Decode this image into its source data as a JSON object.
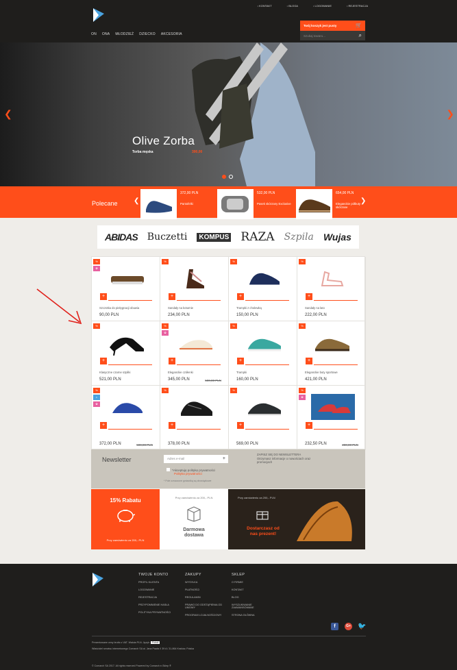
{
  "header": {
    "top_links": [
      "KONTAKT",
      "BLOGA",
      "LOGOWANIE",
      "REJESTRACJA"
    ],
    "nav": [
      "ON",
      "ONA",
      "MŁODZIEŻ",
      "DZIECKO",
      "AKCESORIA"
    ],
    "cart_label": "Twój koszyk jest pusty",
    "search_placeholder": "Szukaj towaru..."
  },
  "hero": {
    "title": "Olive Zorba",
    "subtitle": "Torba męska",
    "price": "390,00"
  },
  "recommended": {
    "title": "Polecane",
    "items": [
      {
        "price": "372,00 PLN",
        "name": "Pantofelki"
      },
      {
        "price": "532,00 PLN",
        "name": "Pasek skórzany Exclusive"
      },
      {
        "price": "654,00 PLN",
        "name": "Eleganckie półbuty skórzane"
      }
    ]
  },
  "brands": [
    "ABIDAS",
    "Buczetti",
    "KOMPUS",
    "RAZA",
    "Szpila",
    "Wujas"
  ],
  "products": [
    {
      "name": "Szczotka do pielęgnacji obuwia",
      "price": "90,00 PLN",
      "old": "",
      "badges": [
        "%",
        "✿"
      ]
    },
    {
      "name": "Sandały na koturnie",
      "price": "234,00 PLN",
      "old": "",
      "badges": [
        "%"
      ]
    },
    {
      "name": "Trampki z cholewką",
      "price": "150,00 PLN",
      "old": "",
      "badges": [
        "%"
      ]
    },
    {
      "name": "Sandały na lato",
      "price": "222,00 PLN",
      "old": "",
      "badges": [
        "%"
      ]
    },
    {
      "name": "Klasyczne czarne szpilki",
      "price": "521,00 PLN",
      "old": "",
      "badges": [
        "%"
      ]
    },
    {
      "name": "Eleganckie czółenki",
      "price": "345,00 PLN",
      "old": "500,00 PLN",
      "badges": [
        "%",
        "✿"
      ]
    },
    {
      "name": "Trampki",
      "price": "160,00 PLN",
      "old": "",
      "badges": [
        "%"
      ]
    },
    {
      "name": "Eleganckie buty sportowe",
      "price": "421,00 PLN",
      "old": "",
      "badges": [
        "%"
      ]
    },
    {
      "name": "",
      "price": "372,00 PLN",
      "old": "500,00 PLN",
      "badges": [
        "%",
        "☼",
        "✿"
      ]
    },
    {
      "name": "",
      "price": "378,00 PLN",
      "old": "",
      "badges": [
        "%"
      ]
    },
    {
      "name": "",
      "price": "569,00 PLN",
      "old": "",
      "badges": [
        "%"
      ]
    },
    {
      "name": "",
      "price": "232,50 PLN",
      "old": "280,00 PLN",
      "badges": [
        "%",
        "✿"
      ]
    }
  ],
  "newsletter": {
    "title": "Newsletter",
    "placeholder": "Adres e-mail",
    "accept": "*Akceptuję politykę prywatności",
    "policy": "Polityka prywatności",
    "note": "* Pole oznaczone gwiazdką są obowiązkowe",
    "side_title": "ZAPISZ SIĘ DO NEWSLETTERA",
    "side_text": "Otrzymasz informacje o nowościach oraz promocjach"
  },
  "promos": {
    "p1_title": "15% Rabatu",
    "p1_sub": "Przy zamówieniu za 200,- PLN",
    "p2_top": "Przy zamówieniu za 200,- PLN",
    "p2_title": "Darmowa dostawa",
    "p3_top": "Przy zamówieniu za 200,- PLN",
    "p3_title": "Dostarczasz od nas prezent!"
  },
  "footer": {
    "cols": [
      {
        "h": "TWOJE KONTO",
        "items": [
          "PROFIL KLIENTA",
          "LOGOWANIE",
          "REJESTRACJA",
          "PRZYPOMNIENIE HASŁA",
          "POLITYKA PRYWATNOŚCI"
        ]
      },
      {
        "h": "ZAKUPY",
        "items": [
          "WYSYŁKA",
          "PŁATNOŚCI",
          "REGULAMIN",
          "PRAWO DO ODSTĄPIENIA OD UMOWY",
          "PROGRAM LOJALNOŚCIOWY"
        ]
      },
      {
        "h": "SKLEP",
        "items": [
          "O FIRMIE",
          "KONTAKT",
          "BLOG",
          "WYSZUKIWANIE ZAAWANSOWANE",
          "STRONA GŁÓWNA"
        ]
      }
    ],
    "prices_line": "Prezentowane ceny brutto z VAT. Waluta PLN. Język:",
    "language": "Polski",
    "legal": "Właściciel serwisu internetowego Comarch SA al. Jana Pawła II 39 A / 31-864 Kraków, Polska",
    "copyright": "© Comarch SA 2017. All rights reserved Powered by Comarch e-Sklep ®"
  },
  "colors": {
    "accent": "#ff4e1a",
    "dark": "#1f1e1c",
    "bg": "#efede9"
  }
}
